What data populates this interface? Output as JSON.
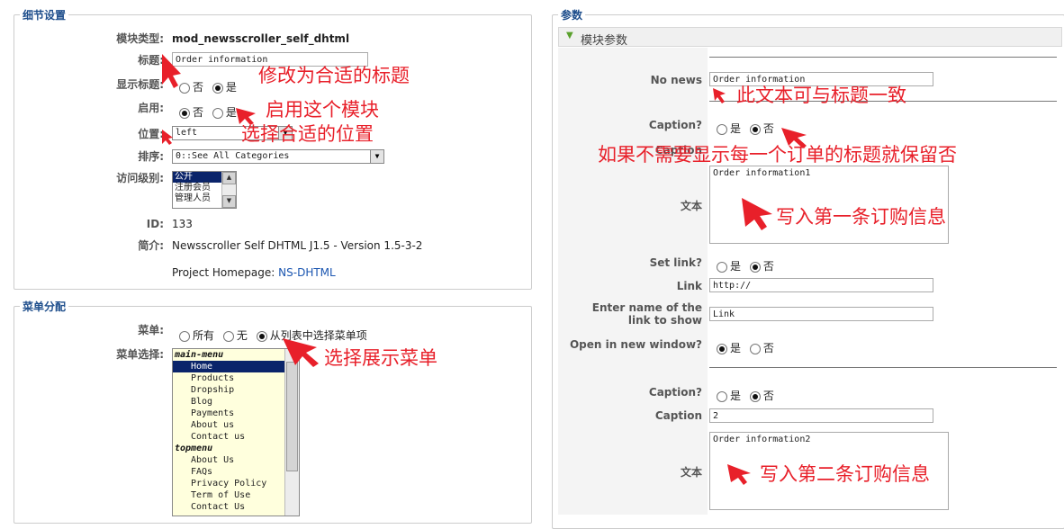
{
  "details": {
    "legend": "细节设置",
    "module_type_label": "模块类型:",
    "module_type_value": "mod_newsscroller_self_dhtml",
    "title_label": "标题:",
    "title_value": "Order information",
    "show_title_label": "显示标题:",
    "show_title_no": "否",
    "show_title_yes": "是",
    "enabled_label": "启用:",
    "enabled_no": "否",
    "enabled_yes": "是",
    "position_label": "位置:",
    "position_value": "left",
    "order_label": "排序:",
    "order_value": "0::See All Categories",
    "access_label": "访问级别:",
    "access_options": [
      "公开",
      "注册会员",
      "管理人员"
    ],
    "id_label": "ID:",
    "id_value": "133",
    "intro_label": "简介:",
    "intro_value": "Newsscroller Self DHTML J1.5 - Version 1.5-3-2",
    "homepage_prefix": "Project Homepage:",
    "homepage_link": "NS-DHTML"
  },
  "menu": {
    "legend": "菜单分配",
    "menus_label": "菜单:",
    "opt_all": "所有",
    "opt_none": "无",
    "opt_select": "从列表中选择菜单项",
    "select_label": "菜单选择:",
    "groups": [
      {
        "name": "main-menu",
        "items": [
          "Home",
          "Products",
          "Dropship",
          "Blog",
          "Payments",
          "About us",
          "Contact us"
        ]
      },
      {
        "name": "topmenu",
        "items": [
          "About Us",
          "FAQs",
          "Privacy Policy",
          "Term of Use",
          "Contact Us"
        ]
      }
    ]
  },
  "params": {
    "legend": "参数",
    "section_title": "模块参数",
    "no_news_label": "No news",
    "no_news_value": "Order information",
    "caption_q_label": "Caption?",
    "yes": "是",
    "no": "否",
    "caption_label": "Caption",
    "text_label": "文本",
    "text1_value": "Order information1",
    "set_link_label": "Set link?",
    "link_label": "Link",
    "link_value": "http://",
    "link_name_label": "Enter name of the link to show",
    "link_name_value": "Link",
    "new_window_label": "Open in new window?",
    "caption2_value": "2",
    "text2_value": "Order information2"
  },
  "annotations": {
    "title": "修改为合适的标题",
    "enable": "启用这个模块",
    "position": "选择合适的位置",
    "menu": "选择展示菜单",
    "no_news": "此文本可与标题一致",
    "caption": "如果不需要显示每一个订单的标题就保留否",
    "text1": "写入第一条订购信息",
    "text2": "写入第二条订购信息"
  },
  "colors": {
    "annotation": "#e8202a",
    "legend": "#1e4e8c",
    "selection": "#0a246a"
  }
}
